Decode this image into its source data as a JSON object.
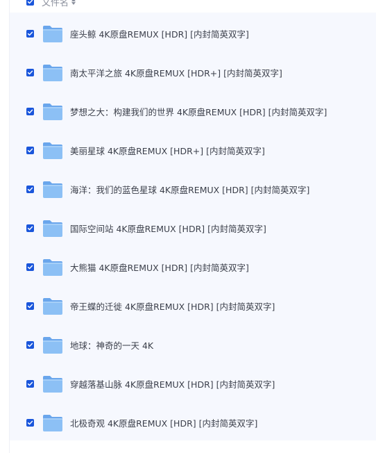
{
  "header": {
    "label": "文件名"
  },
  "colors": {
    "accent": "#1a56db",
    "folder": "#7ab2ef",
    "panel_bg": "#f6f8fe"
  },
  "files": [
    {
      "name": "座头鲸 4K原盘REMUX [HDR] [内封简英双字]",
      "checked": true
    },
    {
      "name": "南太平洋之旅 4K原盘REMUX [HDR+] [内封简英双字]",
      "checked": true
    },
    {
      "name": "梦想之大：构建我们的世界 4K原盘REMUX [HDR] [内封简英双字]",
      "checked": true
    },
    {
      "name": "美丽星球 4K原盘REMUX [HDR+] [内封简英双字]",
      "checked": true
    },
    {
      "name": "海洋：我们的蓝色星球 4K原盘REMUX [HDR] [内封简英双字]",
      "checked": true
    },
    {
      "name": "国际空间站 4K原盘REMUX [HDR] [内封简英双字]",
      "checked": true
    },
    {
      "name": "大熊猫 4K原盘REMUX [HDR] [内封简英双字]",
      "checked": true
    },
    {
      "name": "帝王蝶的迁徙 4K原盘REMUX [HDR] [内封简英双字]",
      "checked": true
    },
    {
      "name": "地球：神奇的一天 4K",
      "checked": true
    },
    {
      "name": "穿越落基山脉 4K原盘REMUX [HDR] [内封简英双字]",
      "checked": true
    },
    {
      "name": "北极奇观 4K原盘REMUX [HDR] [内封简英双字]",
      "checked": true
    }
  ]
}
